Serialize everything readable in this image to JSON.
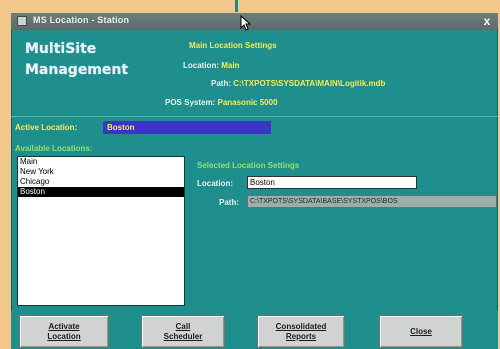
{
  "window": {
    "title": "MS Location - Station",
    "close_glyph": "x",
    "cursor_icon": "arrow-cursor-icon"
  },
  "brand": {
    "line1": "MultiSite",
    "line2": "Management"
  },
  "main_settings": {
    "heading": "Main Location Settings",
    "location_label": "Location:",
    "location_value": "Main",
    "path_label": "Path:",
    "path_value": "C:\\TXPOTS\\SYSDATA\\MAIN\\Logitik.mdb",
    "pos_label": "POS System:",
    "pos_value": "Panasonic 5000"
  },
  "active_location": {
    "label": "Active Location:",
    "value": "Boston"
  },
  "available_locations": {
    "label": "Available Locations:",
    "items": [
      "Main",
      "New York",
      "Chicago",
      "Boston"
    ],
    "selected_index": 3
  },
  "selected_settings": {
    "heading": "Selected Location Settings",
    "location_label": "Location:",
    "location_value": "Boston",
    "path_label": "Path:",
    "path_value": "C:\\TXPOTS\\SYSDATA\\BASE\\SYSTXPOS\\BOS"
  },
  "buttons": {
    "activate_line1": "Activate",
    "activate_line2": "Location",
    "scheduler_line1": "Call",
    "scheduler_line2": "Scheduler",
    "reports_line1": "Consolidated",
    "reports_line2": "Reports",
    "close": "Close"
  },
  "colors": {
    "window_bg": "#1f8f8e",
    "desktop_bg": "#f2c98a",
    "yellow_text": "#f3ec58",
    "green_text": "#8ee16a",
    "active_highlight": "#3b35c6"
  }
}
